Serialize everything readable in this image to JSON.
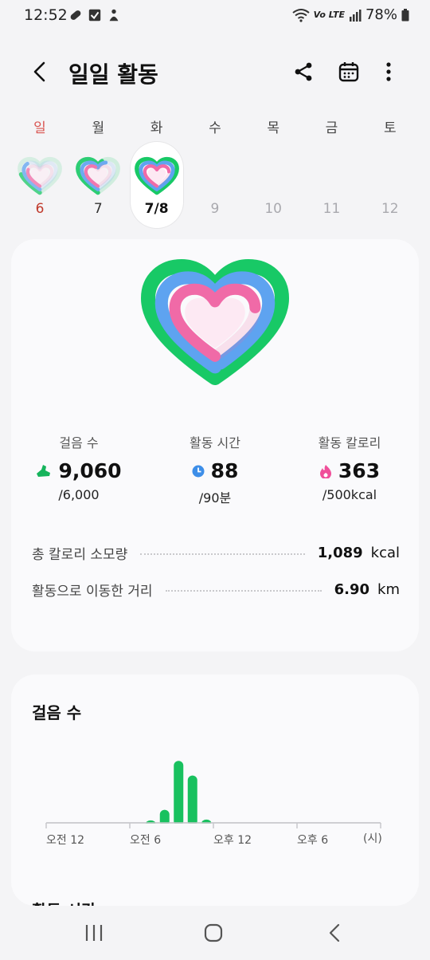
{
  "status_bar": {
    "time": "12:52",
    "network_label": "Vo LTE",
    "battery": "78%"
  },
  "header": {
    "title": "일일 활동",
    "back_icon": "back-arrow-icon",
    "share_icon": "share-icon",
    "calendar_icon": "calendar-icon",
    "more_icon": "more-vert-icon"
  },
  "week": {
    "days": [
      {
        "label": "일",
        "num": "6",
        "kind": "sun",
        "has_data": true,
        "active": false
      },
      {
        "label": "월",
        "num": "7",
        "kind": "normal",
        "has_data": true,
        "active": false
      },
      {
        "label": "화",
        "num": "7/8",
        "kind": "normal",
        "has_data": true,
        "active": true
      },
      {
        "label": "수",
        "num": "9",
        "kind": "future",
        "has_data": false,
        "active": false
      },
      {
        "label": "목",
        "num": "10",
        "kind": "future",
        "has_data": false,
        "active": false
      },
      {
        "label": "금",
        "num": "11",
        "kind": "future",
        "has_data": false,
        "active": false
      },
      {
        "label": "토",
        "num": "12",
        "kind": "future",
        "has_data": false,
        "active": false
      }
    ]
  },
  "summary": {
    "metrics": [
      {
        "label": "걸음 수",
        "value": "9,060",
        "goal": "/6,000",
        "icon": "shoe-icon",
        "color": "#16b45c"
      },
      {
        "label": "활동 시간",
        "value": "88",
        "goal": "/90분",
        "icon": "clock-icon",
        "color": "#3d8ee8"
      },
      {
        "label": "활동 칼로리",
        "value": "363",
        "goal": "/500kcal",
        "icon": "flame-icon",
        "color": "#f04f9a"
      }
    ],
    "stats": [
      {
        "label": "총 칼로리 소모량",
        "value": "1,089",
        "unit": "kcal"
      },
      {
        "label": "활동으로 이동한 거리",
        "value": "6.90",
        "unit": "km"
      }
    ],
    "rings": {
      "steps_progress": 1.0,
      "active_time_progress": 0.98,
      "calories_progress": 0.73,
      "colors": {
        "steps": "#18c966",
        "active_time": "#5ea3f0",
        "calories": "#f06aa7"
      }
    }
  },
  "steps_card": {
    "title": "걸음 수",
    "next_title": "활동 시간",
    "axis_labels": [
      "오전 12",
      "오전 6",
      "오후 12",
      "오후 6",
      "(시)"
    ]
  },
  "chart_data": {
    "type": "bar",
    "title": "걸음 수",
    "xlabel": "(시)",
    "x_tick_labels": [
      "오전 12",
      "오전 6",
      "오후 12",
      "오후 6"
    ],
    "x": [
      7,
      8,
      9,
      10,
      11
    ],
    "values": [
      150,
      800,
      3800,
      2900,
      200
    ],
    "bar_color": "#19c15f",
    "xlim": [
      0,
      24
    ],
    "ylim": [
      0,
      4200
    ],
    "grid": false
  },
  "nav_bar": {
    "recents_icon": "recents-icon",
    "home_icon": "home-icon",
    "back_icon": "nav-back-icon"
  }
}
